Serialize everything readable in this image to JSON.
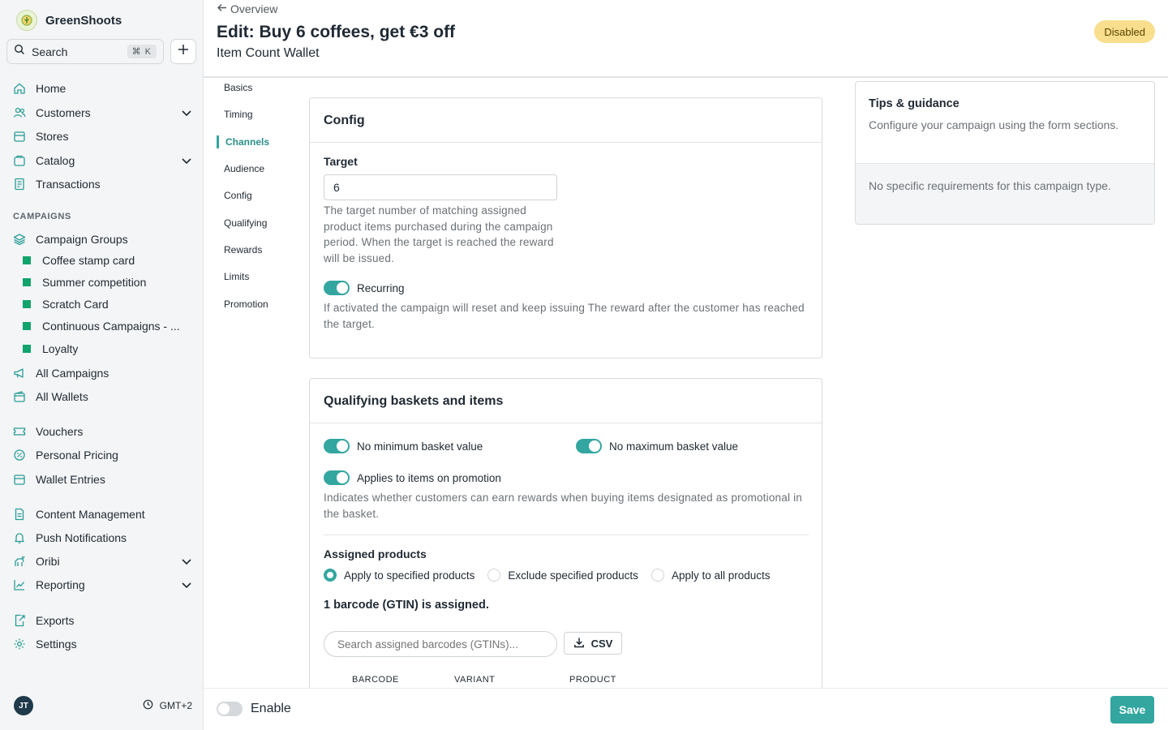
{
  "app": {
    "name": "GreenShoots"
  },
  "search": {
    "label": "Search",
    "shortcut": "⌘ K"
  },
  "nav": {
    "home": "Home",
    "customers": "Customers",
    "stores": "Stores",
    "catalog": "Catalog",
    "transactions": "Transactions",
    "campaigns_section": "CAMPAIGNS",
    "campaign_groups": "Campaign Groups",
    "groups": [
      "Coffee stamp card",
      "Summer competition",
      "Scratch Card",
      "Continuous Campaigns - ...",
      "Loyalty"
    ],
    "all_campaigns": "All Campaigns",
    "all_wallets": "All Wallets",
    "vouchers": "Vouchers",
    "personal_pricing": "Personal Pricing",
    "wallet_entries": "Wallet Entries",
    "content_management": "Content Management",
    "push_notifications": "Push Notifications",
    "oribi": "Oribi",
    "reporting": "Reporting",
    "exports": "Exports",
    "settings": "Settings"
  },
  "user": {
    "initials": "JT",
    "timezone": "GMT+2"
  },
  "header": {
    "back_label": "Overview",
    "title": "Edit: Buy 6 coffees, get €3 off",
    "subtitle": "Item Count Wallet",
    "status": "Disabled"
  },
  "section_nav": [
    "Basics",
    "Timing",
    "Channels",
    "Audience",
    "Config",
    "Qualifying",
    "Rewards",
    "Limits",
    "Promotion"
  ],
  "section_nav_active": "Channels",
  "config": {
    "heading": "Config",
    "target_label": "Target",
    "target_value": "6",
    "target_help": "The target number of matching assigned product items purchased during the campaign period. When the target is reached the reward will be issued.",
    "recurring_label": "Recurring",
    "recurring_on": true,
    "recurring_help": "If activated the campaign will reset and keep issuing The reward after the customer has reached the target."
  },
  "qualifying": {
    "heading": "Qualifying baskets and items",
    "no_min_label": "No minimum basket value",
    "no_max_label": "No maximum basket value",
    "promo_label": "Applies to items on promotion",
    "promo_help": "Indicates whether customers can earn rewards when buying items designated as promotional in the basket.",
    "assigned_label": "Assigned products",
    "radio_options": [
      "Apply to specified products",
      "Exclude specified products",
      "Apply to all products"
    ],
    "radio_selected": "Apply to specified products",
    "assigned_note": "1 barcode (GTIN) is assigned.",
    "search_placeholder": "Search assigned barcodes (GTINs)...",
    "csv_label": "CSV",
    "columns": [
      "BARCODE",
      "VARIANT",
      "PRODUCT"
    ]
  },
  "tips": {
    "title": "Tips & guidance",
    "description": "Configure your campaign using the form sections.",
    "note": "No specific requirements for this campaign type."
  },
  "footer": {
    "enable_label": "Enable",
    "enabled": false,
    "save_label": "Save"
  },
  "colors": {
    "accent": "#33a6a0",
    "group_marker": "#10a36b",
    "badge_bg": "#f8de8d",
    "sidebar_bg": "#f4f5f6"
  }
}
